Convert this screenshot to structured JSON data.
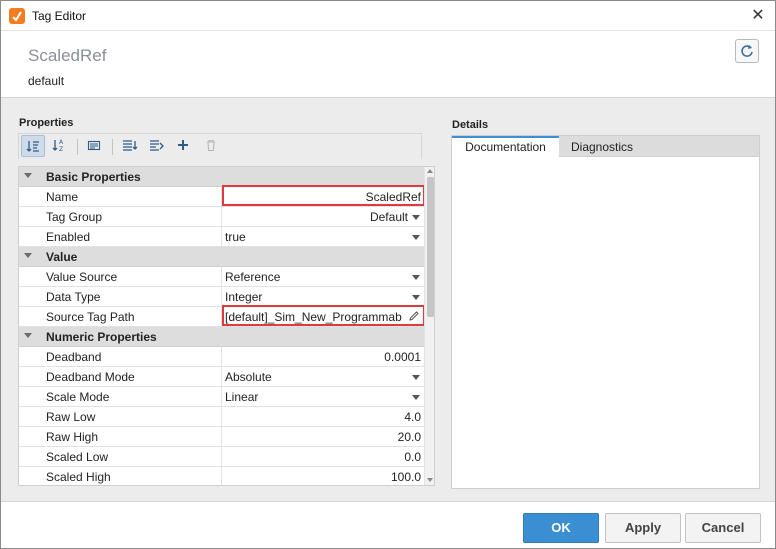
{
  "window": {
    "title": "Tag Editor",
    "close_glyph": "✕",
    "icon": "app-logo-icon"
  },
  "header": {
    "tag_name": "ScaledRef",
    "provider": "default"
  },
  "properties": {
    "section_label": "Properties",
    "toolbar": [
      {
        "icon": "sort-category-icon",
        "active": true
      },
      {
        "icon": "sort-alpha-icon",
        "active": false
      },
      {
        "icon": "property-pages-icon",
        "active": false
      },
      {
        "icon": "expand-all-icon",
        "active": false
      },
      {
        "icon": "collapse-all-icon",
        "active": false
      },
      {
        "icon": "add-icon",
        "active": false
      },
      {
        "icon": "delete-icon",
        "active": false
      }
    ],
    "groups": [
      {
        "label": "Basic Properties",
        "rows": [
          {
            "name": "Name",
            "value": "ScaledRef",
            "align": "right",
            "dropdown": false
          },
          {
            "name": "Tag Group",
            "value": "Default",
            "align": "right",
            "dropdown": true
          },
          {
            "name": "Enabled",
            "value": "true",
            "align": "left",
            "dropdown": true
          }
        ]
      },
      {
        "label": "Value",
        "rows": [
          {
            "name": "Value Source",
            "value": "Reference",
            "align": "left",
            "dropdown": true
          },
          {
            "name": "Data Type",
            "value": "Integer",
            "align": "left",
            "dropdown": true
          },
          {
            "name": "Source Tag Path",
            "value": "[default]_Sim_New_Programmab",
            "align": "left",
            "dropdown": false,
            "edit": true
          }
        ]
      },
      {
        "label": "Numeric Properties",
        "rows": [
          {
            "name": "Deadband",
            "value": "0.0001",
            "align": "right",
            "dropdown": false
          },
          {
            "name": "Deadband Mode",
            "value": "Absolute",
            "align": "left",
            "dropdown": true
          },
          {
            "name": "Scale Mode",
            "value": "Linear",
            "align": "left",
            "dropdown": true
          },
          {
            "name": "Raw Low",
            "value": "4.0",
            "align": "right",
            "dropdown": false
          },
          {
            "name": "Raw High",
            "value": "20.0",
            "align": "right",
            "dropdown": false
          },
          {
            "name": "Scaled Low",
            "value": "0.0",
            "align": "right",
            "dropdown": false
          },
          {
            "name": "Scaled High",
            "value": "100.0",
            "align": "right",
            "dropdown": false
          }
        ]
      }
    ]
  },
  "details": {
    "section_label": "Details",
    "tabs": [
      {
        "label": "Documentation",
        "active": true
      },
      {
        "label": "Diagnostics",
        "active": false
      }
    ]
  },
  "footer": {
    "ok_label": "OK",
    "apply_label": "Apply",
    "cancel_label": "Cancel"
  },
  "colors": {
    "accent": "#3a8fd2",
    "highlight": "#e0393e",
    "app_icon": "#f47c20"
  }
}
